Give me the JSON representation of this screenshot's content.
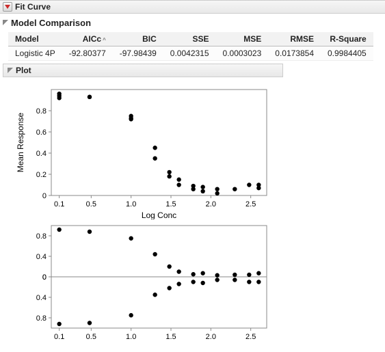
{
  "panel": {
    "title": "Fit Curve"
  },
  "model_comparison": {
    "title": "Model Comparison",
    "headers": [
      "Model",
      "AICc",
      "BIC",
      "SSE",
      "MSE",
      "RMSE",
      "R-Square"
    ],
    "sort_col": 1,
    "rows": [
      {
        "cells": [
          "Logistic 4P",
          "-92.80377",
          "-97.98439",
          "0.0042315",
          "0.0003023",
          "0.0173854",
          "0.9984405"
        ]
      }
    ]
  },
  "plot": {
    "title": "Plot"
  },
  "chart_data": [
    {
      "type": "scatter",
      "xlabel": "Log Conc",
      "ylabel": "Mean Response",
      "xlim": [
        0,
        2.7
      ],
      "ylim": [
        0,
        1.0
      ],
      "xticks": [
        0.1,
        0.5,
        1.0,
        1.5,
        2.0,
        2.5
      ],
      "yticks": [
        0,
        0.2,
        0.4,
        0.6,
        0.8
      ],
      "series": [
        {
          "name": "points",
          "x": [
            0.1,
            0.1,
            0.1,
            0.48,
            0.48,
            1.0,
            1.0,
            1.0,
            1.3,
            1.3,
            1.48,
            1.48,
            1.6,
            1.6,
            1.78,
            1.78,
            1.9,
            1.9,
            2.08,
            2.08,
            2.3,
            2.48,
            2.6,
            2.6
          ],
          "y": [
            0.96,
            0.94,
            0.92,
            0.93,
            0.93,
            0.75,
            0.73,
            0.72,
            0.45,
            0.35,
            0.22,
            0.18,
            0.15,
            0.1,
            0.06,
            0.09,
            0.04,
            0.08,
            0.02,
            0.06,
            0.06,
            0.1,
            0.1,
            0.07
          ]
        }
      ]
    },
    {
      "type": "scatter",
      "xlabel": "",
      "ylabel": "",
      "xlim": [
        0,
        2.7
      ],
      "ylim_top": [
        0,
        1.0
      ],
      "ylim_bot": [
        1.0,
        0
      ],
      "xticks": [
        0.1,
        0.5,
        1.0,
        1.5,
        2.0,
        2.5
      ],
      "yticks_top": [
        0,
        0.4,
        0.8
      ],
      "yticks_bot": [
        0.8,
        0.4,
        0
      ],
      "series": [
        {
          "name": "top",
          "x": [
            0.1,
            0.48,
            1.0,
            1.3,
            1.48,
            1.6,
            1.78,
            1.9,
            2.08,
            2.3,
            2.48,
            2.6
          ],
          "y": [
            0.92,
            0.88,
            0.75,
            0.44,
            0.2,
            0.1,
            0.05,
            0.07,
            0.03,
            0.04,
            0.04,
            0.07
          ]
        },
        {
          "name": "bottom",
          "x": [
            0.1,
            0.48,
            1.0,
            1.3,
            1.48,
            1.6,
            1.78,
            1.9,
            2.08,
            2.3,
            2.48,
            2.6
          ],
          "y": [
            0.92,
            0.9,
            0.75,
            0.35,
            0.22,
            0.14,
            0.1,
            0.12,
            0.06,
            0.06,
            0.1,
            0.1
          ]
        }
      ]
    }
  ]
}
